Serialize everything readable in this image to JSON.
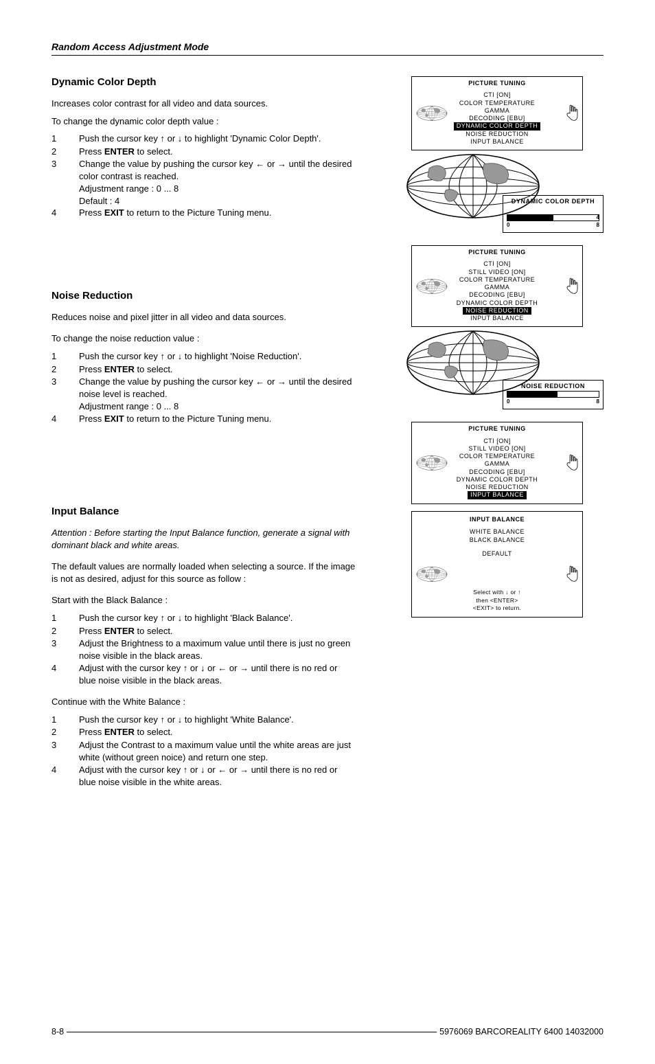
{
  "header": "Random Access Adjustment Mode",
  "sections": {
    "dcd": {
      "title": "Dynamic Color Depth",
      "p1": "Increases color contrast for all video and data sources.",
      "p2": "To change the dynamic color depth value :",
      "s1": "Push the cursor key ↑ or ↓ to highlight 'Dynamic Color Depth'.",
      "s2a": "Press ",
      "s2b": "ENTER",
      "s2c": " to select.",
      "s3": "Change the value by pushing the cursor key ← or → until the desired color contrast is reached.",
      "s3b": "Adjustment range : 0 ... 8",
      "s3c": "Default : 4",
      "s4a": "Press ",
      "s4b": "EXIT",
      "s4c": " to return to the Picture Tuning menu."
    },
    "nr": {
      "title": "Noise Reduction",
      "p1": "Reduces noise and pixel jitter in all video and data sources.",
      "p2": "To change the noise reduction value :",
      "s1": "Push the cursor key ↑ or ↓ to highlight 'Noise Reduction'.",
      "s2a": "Press ",
      "s2b": "ENTER",
      "s2c": " to select.",
      "s3": "Change the value by pushing the cursor key ← or → until the desired noise level is reached.",
      "s3b": "Adjustment range : 0 ... 8",
      "s4a": "Press ",
      "s4b": "EXIT",
      "s4c": " to return to the Picture Tuning menu."
    },
    "ib": {
      "title": "Input Balance",
      "p1": "Attention : Before starting the Input Balance function, generate a signal with dominant black and white areas.",
      "p2": "The default values are normally loaded when selecting a source.  If the image is not as desired, adjust for this source as follow :",
      "p3": "Start with the Black Balance :",
      "bs1": "Push the cursor key ↑ or ↓ to highlight 'Black Balance'.",
      "bs2a": "Press ",
      "bs2b": "ENTER",
      "bs2c": " to select.",
      "bs3": "Adjust the Brightness to a maximum value until there is just no green noise visible in the black areas.",
      "bs4": "Adjust with the cursor key ↑ or ↓ or ← or → until there is no red or blue noise visible in the black areas.",
      "p4": "Continue with the White Balance :",
      "ws1": "Push the cursor key ↑ or ↓ to highlight 'White Balance'.",
      "ws2a": "Press ",
      "ws2b": "ENTER",
      "ws2c": " to select.",
      "ws3": "Adjust the Contrast to a maximum value until the white areas are just white (without green noice) and return one step.",
      "ws4": "Adjust with the cursor key ↑ or ↓ or ← or → until there is no red or blue noise visible in the white areas."
    }
  },
  "menus": {
    "m1": {
      "title": "PICTURE TUNING",
      "i1": "CTI [ON]",
      "i2": "COLOR TEMPERATURE",
      "i3": "GAMMA",
      "i4": "DECODING [EBU]",
      "hi": "DYNAMIC COLOR DEPTH",
      "i5": "NOISE REDUCTION",
      "i6": "INPUT BALANCE"
    },
    "slider1": {
      "title": "DYNAMIC COLOR DEPTH",
      "val": "4",
      "min": "0",
      "max": "8"
    },
    "m2": {
      "title": "PICTURE TUNING",
      "i1": "CTI [ON]",
      "i2": "STILL VIDEO [ON]",
      "i3": "COLOR TEMPERATURE",
      "i4": "GAMMA",
      "i5": "DECODING [EBU]",
      "i6": "DYNAMIC COLOR DEPTH",
      "hi": "NOISE REDUCTION",
      "i7": "INPUT BALANCE"
    },
    "slider2": {
      "title": "NOISE REDUCTION",
      "min": "0",
      "max": "8"
    },
    "m3": {
      "title": "PICTURE TUNING",
      "i1": "CTI [ON]",
      "i2": "STILL VIDEO [ON]",
      "i3": "COLOR TEMPERATURE",
      "i4": "GAMMA",
      "i5": "DECODING [EBU]",
      "i6": "DYNAMIC COLOR DEPTH",
      "i7": "NOISE REDUCTION",
      "hi": "INPUT BALANCE"
    },
    "m4": {
      "title": "INPUT BALANCE",
      "i1": "WHITE BALANCE",
      "i2": "BLACK BALANCE",
      "i3": "DEFAULT",
      "f1": "Select with  ↓  or ↑",
      "f2": "then <ENTER>",
      "f3": "<EXIT> to return."
    }
  },
  "footer": {
    "left": "8-8",
    "right": "5976069 BARCOREALITY 6400 14032000"
  }
}
